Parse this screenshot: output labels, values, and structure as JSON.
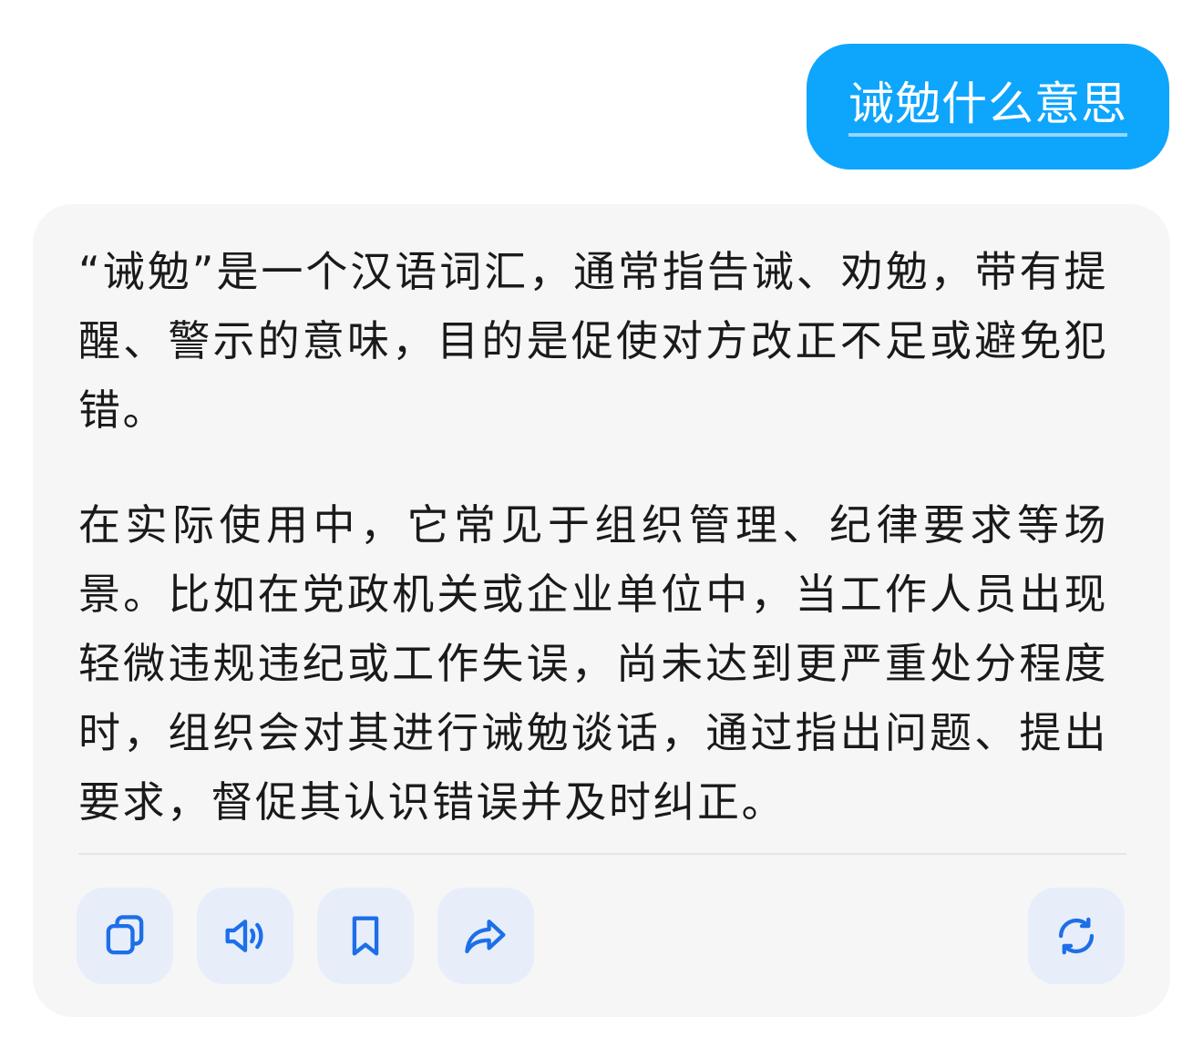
{
  "conversation": {
    "user_message": "诫勉什么意思",
    "assistant_reply": {
      "paragraphs": [
        "“诫勉”是一个汉语词汇，通常指告诫、劝勉，带有提醒、警示的意味，目的是促使对方改正不足或避免犯错。",
        "在实际使用中，它常见于组织管理、纪律要求等场景。比如在党政机关或企业单位中，当工作人员出现轻微违规违纪或工作失误，尚未达到更严重处分程度时，组织会对其进行诫勉谈话，通过指出问题、提出要求，督促其认识错误并及时纠正。"
      ]
    }
  },
  "actions": {
    "copy_icon": "copy-icon",
    "speaker_icon": "speaker-icon",
    "bookmark_icon": "bookmark-icon",
    "share_icon": "share-icon",
    "regenerate_icon": "refresh-icon"
  },
  "colors": {
    "user_bubble": "#0ea5fd",
    "card_background": "#f6f6f7",
    "icon_accent": "#1d6fe8",
    "button_background": "#e7eefa",
    "text": "#1a1a1a"
  }
}
